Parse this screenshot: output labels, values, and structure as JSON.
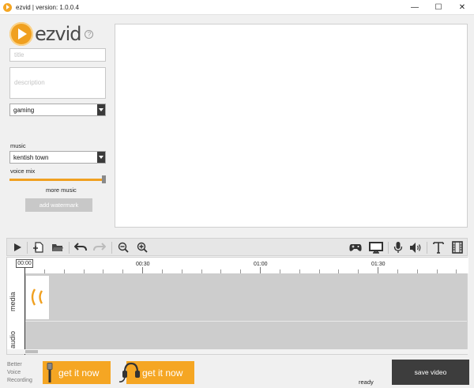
{
  "window": {
    "title": "ezvid | version: 1.0.0.4",
    "minimize": "—",
    "maximize": "☐",
    "close": "✕"
  },
  "logo": {
    "text": "ezvid",
    "help": "?"
  },
  "form": {
    "title_placeholder": "title",
    "description_placeholder": "description",
    "category_value": "gaming",
    "music_label": "music",
    "music_value": "kentish town",
    "voice_mix_label": "voice mix",
    "voice_mix_level": 0.97,
    "more_music": "more music",
    "add_watermark": "add watermark"
  },
  "toolbar": {
    "left_icons": [
      "play-icon",
      "add-media-icon",
      "open-folder-icon",
      "undo-icon",
      "redo-icon",
      "zoom-out-icon",
      "zoom-in-icon"
    ],
    "right_icons": [
      "gamepad-icon",
      "monitor-icon",
      "microphone-icon",
      "speaker-icon",
      "text-icon",
      "film-icon"
    ]
  },
  "timeline": {
    "playhead": "00:00",
    "marks": [
      "00:30",
      "01:00",
      "01:30"
    ],
    "tracks": [
      "media",
      "audio"
    ]
  },
  "footer": {
    "promo_text": [
      "Better",
      "Voice",
      "Recording"
    ],
    "get_it_now_1": "get it now",
    "get_it_now_2": "get it now",
    "status": "ready",
    "save_video": "save video"
  },
  "colors": {
    "accent": "#f5a623",
    "save_button": "#3d3d3d",
    "timeline_track": "#cdcdcd"
  }
}
